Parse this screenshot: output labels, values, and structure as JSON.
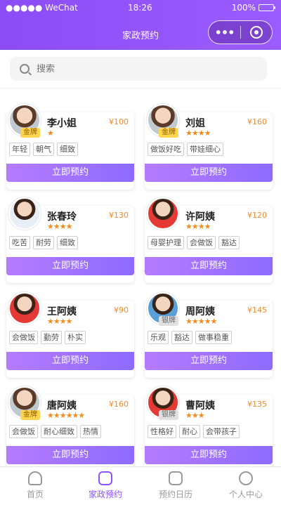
{
  "status": {
    "carrier": "●●●●● WeChat",
    "time": "18:26",
    "battery": "100%"
  },
  "nav": {
    "title": "家政预约",
    "more_label": "•••"
  },
  "search": {
    "placeholder": "搜索"
  },
  "book_label": "立即预约",
  "workers": [
    {
      "name": "李小姐",
      "price": "¥100",
      "badge": "金牌",
      "stars": "★",
      "tags": [
        "年轻",
        "朝气",
        "细致"
      ]
    },
    {
      "name": "刘姐",
      "price": "¥160",
      "badge": "金牌",
      "stars": "★★★★",
      "tags": [
        "做饭好吃",
        "带娃细心"
      ]
    },
    {
      "name": "张春玲",
      "price": "¥130",
      "badge": "",
      "stars": "★★★★",
      "tags": [
        "吃苦",
        "耐劳",
        "细致"
      ]
    },
    {
      "name": "许阿姨",
      "price": "¥120",
      "badge": "",
      "stars": "★★★★",
      "tags": [
        "母婴护理",
        "会做饭",
        "豁达"
      ]
    },
    {
      "name": "王阿姨",
      "price": "¥90",
      "badge": "",
      "stars": "★★★★",
      "tags": [
        "会做饭",
        "勤劳",
        "朴实"
      ]
    },
    {
      "name": "周阿姨",
      "price": "¥145",
      "badge": "银牌",
      "stars": "★★★★★",
      "tags": [
        "乐观",
        "豁达",
        "做事稳重"
      ]
    },
    {
      "name": "唐阿姨",
      "price": "¥160",
      "badge": "金牌",
      "stars": "★★★★★★",
      "tags": [
        "会做饭",
        "耐心细致",
        "热情"
      ]
    },
    {
      "name": "曹阿姨",
      "price": "¥135",
      "badge": "银牌",
      "stars": "★★★",
      "tags": [
        "性格好",
        "耐心",
        "会带孩子"
      ]
    }
  ],
  "tabbar": {
    "items": [
      {
        "label": "首页"
      },
      {
        "label": "家政预约"
      },
      {
        "label": "预约日历"
      },
      {
        "label": "个人中心"
      }
    ]
  },
  "colors": {
    "accent": "#8b56ff",
    "price": "#ef8a2b",
    "star": "#f28c1c"
  }
}
